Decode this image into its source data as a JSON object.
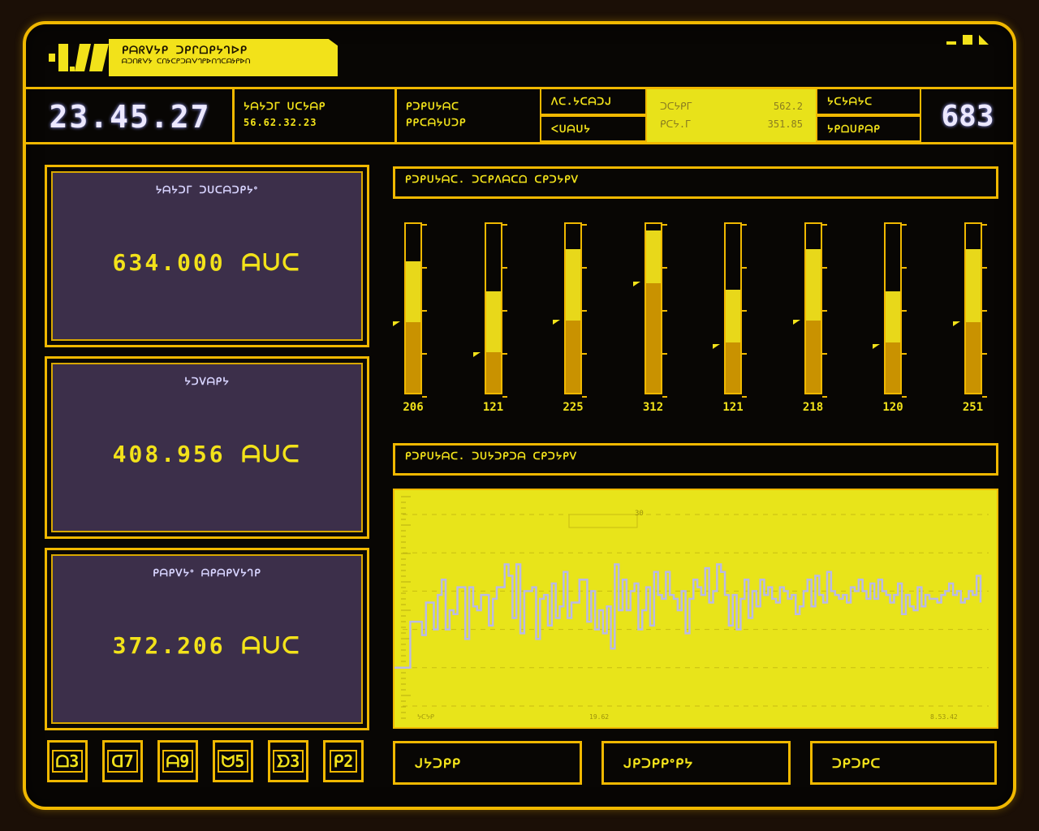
{
  "header": {
    "logo_mark": "▪▮.▮▮",
    "title": "ᑭᗩᖇᐯᔭᑭ ᑐᑭᒋᗝᑭᔭᒉᐅᑭ",
    "subtitle": "ᗩᑐᑎᖇᐯᔭ ᑕᑎᔭᑕᑭᑐᗩᐯᒉᑭᐅᑎᒉᑕᗩᔭᑭᐅᑎ"
  },
  "info_strip": {
    "clock": "23.45.27",
    "coord_label": "ᔭᗩᔭᑐᒥ ᑌᑕᔭᗩᑭ",
    "coord_value": "56.62.32.23",
    "status_line1": "ᑭᑐᑭᑌᔭᗩᑕ",
    "status_line2": "ᑭᑭᑕᗩᔭᑌᑐᑭ",
    "cell_top": "ᐱᑕ.ᔭᑕᗩᑐᒍ",
    "cell_bottom": "ᐸᑌᗩᑌᔭ",
    "readout_label1": "ᑐᑕᔭᑭᒥ",
    "readout_value1": "562.2",
    "readout_label2": "ᑭᑕᔭ.ᒥ",
    "readout_value2": "351.85",
    "flag_top": "ᔭᑕᔭᗩᔭᑕ",
    "flag_bottom": "ᔭᑭᗝᑌᑭᗩᑭ",
    "counter": "683"
  },
  "stats": [
    {
      "label": "ᔭᗩᔭᑐᒥ ᑐᑌᑕᗩᑐᑭᔭᐤ",
      "value": "634.000 ᗩᑌᑕ"
    },
    {
      "label": "ᔭᑐᐯᗩᑭᔭ",
      "value": "408.956 ᗩᑌᑕ"
    },
    {
      "label": "ᑭᗩᑭᐯᔭᐤ ᗩᑭᗩᑭᐯᔭᒉᑭ",
      "value": "372.206 ᗩᑌᑕ"
    }
  ],
  "bar_section": {
    "title": "ᑭᑐᑭᑌᔭᗩᑕ. ᑐᑕᑭᐱᗩᑕᗝ ᑕᑭᑐᔭᑭᐯ"
  },
  "line_section": {
    "title": "ᑭᑐᑭᑌᔭᗩᑕ. ᑐᑌᔭᑐᑭᑐᗩ ᑕᑭᑐᔭᑭᐯ"
  },
  "bars": [
    {
      "label": "206",
      "level": 0.78,
      "inner": 0.42,
      "marker": 0.41
    },
    {
      "label": "121",
      "level": 0.6,
      "inner": 0.24,
      "marker": 0.23
    },
    {
      "label": "225",
      "level": 0.85,
      "inner": 0.43,
      "marker": 0.42
    },
    {
      "label": "312",
      "level": 0.96,
      "inner": 0.65,
      "marker": 0.64
    },
    {
      "label": "121",
      "level": 0.61,
      "inner": 0.3,
      "marker": 0.28
    },
    {
      "label": "218",
      "level": 0.85,
      "inner": 0.43,
      "marker": 0.42
    },
    {
      "label": "120",
      "level": 0.6,
      "inner": 0.3,
      "marker": 0.28
    },
    {
      "label": "251",
      "level": 0.85,
      "inner": 0.42,
      "marker": 0.41
    }
  ],
  "chart_data": {
    "type": "line",
    "title": "",
    "xlabel": "",
    "ylabel": "",
    "x_tick_labels": [
      "ᔭᑕᔭᑭ",
      "19.62",
      "8.53.42"
    ],
    "annotation": "30",
    "values": [
      20,
      20,
      20,
      20,
      44,
      44,
      44,
      37,
      54,
      54,
      40,
      58,
      66,
      40,
      50,
      48,
      62,
      62,
      35,
      62,
      52,
      50,
      58,
      58,
      42,
      56,
      62,
      62,
      74,
      68,
      46,
      74,
      38,
      60,
      60,
      62,
      35,
      56,
      58,
      42,
      64,
      46,
      52,
      70,
      46,
      54,
      54,
      66,
      66,
      44,
      60,
      40,
      50,
      38,
      52,
      30,
      74,
      50,
      66,
      50,
      60,
      64,
      40,
      50,
      62,
      42,
      70,
      58,
      56,
      70,
      58,
      56,
      50,
      60,
      38,
      56,
      66,
      62,
      58,
      72,
      54,
      60,
      74,
      70,
      58,
      42,
      58,
      40,
      56,
      66,
      46,
      60,
      52,
      66,
      58,
      62,
      56,
      54,
      62,
      60,
      56,
      58,
      48,
      52,
      60,
      66,
      52,
      68,
      58,
      54,
      70,
      60,
      58,
      56,
      58,
      54,
      62,
      60,
      66,
      60,
      56,
      64,
      56,
      66,
      60,
      58,
      54,
      58,
      64,
      48,
      58,
      52,
      50,
      62,
      52,
      58,
      56,
      56,
      54,
      58,
      60,
      64,
      58,
      60,
      54,
      56,
      60,
      58,
      68,
      54
    ],
    "ylim": [
      0,
      100
    ]
  },
  "keys": [
    "ᗝ3",
    "ᗡ7",
    "ᗩ9",
    "ᗢ5",
    "ᗤ3",
    "ᑭ2"
  ],
  "actions": [
    "ᒍᔭᑐᑭᑭ",
    "ᒍᑭᑐᑭᑭᐤᑭᔭ",
    "ᑐᑭᑐᑭᑕ"
  ],
  "colors": {
    "accent": "#f0b800",
    "chart_bg": "#e8e41a",
    "panel": "#3c2f4a",
    "line": "#b9b9e6"
  }
}
